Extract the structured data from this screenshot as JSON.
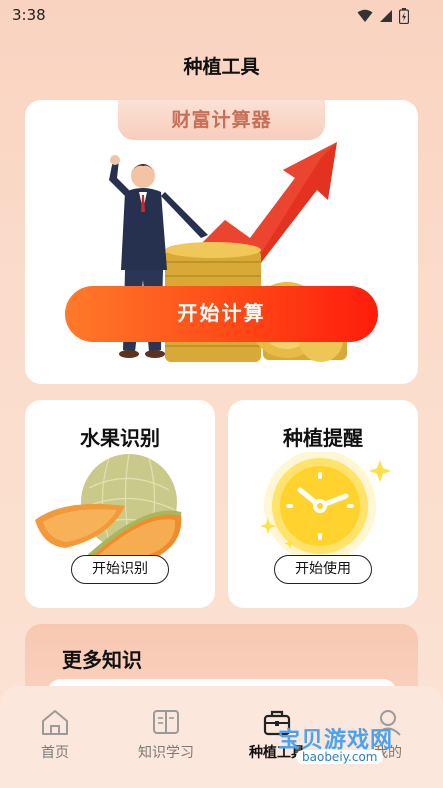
{
  "status_bar": {
    "time": "3:38"
  },
  "page": {
    "title": "种植工具"
  },
  "wealth_calculator": {
    "tab_label": "财富计算器",
    "button_label": "开始计算"
  },
  "fruit_recognition": {
    "title": "水果识别",
    "button_label": "开始识别"
  },
  "planting_reminder": {
    "title": "种植提醒",
    "button_label": "开始使用"
  },
  "more_knowledge": {
    "title": "更多知识"
  },
  "bottom_nav": {
    "items": [
      {
        "label": "首页",
        "icon": "home-icon"
      },
      {
        "label": "知识学习",
        "icon": "book-icon"
      },
      {
        "label": "种植工具",
        "icon": "toolbox-icon"
      },
      {
        "label": "我的",
        "icon": "profile-icon"
      }
    ],
    "active_index": 2
  },
  "watermark": {
    "text": "宝贝游戏网",
    "url": "baobeiy.com"
  }
}
